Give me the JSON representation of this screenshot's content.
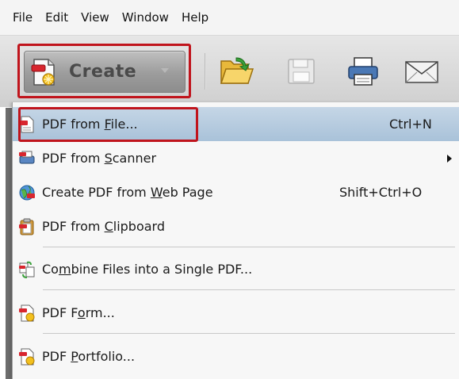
{
  "menubar": {
    "items": [
      "File",
      "Edit",
      "View",
      "Window",
      "Help"
    ]
  },
  "toolbar": {
    "create_label": "Create",
    "icons": [
      "open-folder-icon",
      "save-icon",
      "print-icon",
      "email-icon"
    ]
  },
  "create_menu": {
    "items": [
      {
        "pre": "PDF from ",
        "key": "F",
        "post": "ile...",
        "shortcut": "Ctrl+N",
        "icon": "pdf-from-file-icon",
        "highlighted": true
      },
      {
        "pre": "PDF from ",
        "key": "S",
        "post": "canner",
        "shortcut": "",
        "icon": "scanner-icon",
        "submenu": true
      },
      {
        "pre": "Create PDF from ",
        "key": "W",
        "post": "eb Page",
        "shortcut": "Shift+Ctrl+O",
        "icon": "web-page-icon"
      },
      {
        "pre": "PDF from ",
        "key": "C",
        "post": "lipboard",
        "shortcut": "",
        "icon": "clipboard-icon"
      },
      {
        "pre": "Co",
        "key": "m",
        "post": "bine Files into a Single PDF...",
        "shortcut": "",
        "icon": "combine-files-icon"
      },
      {
        "pre": "PDF F",
        "key": "o",
        "post": "rm...",
        "shortcut": "",
        "icon": "pdf-form-icon"
      },
      {
        "pre": "PDF ",
        "key": "P",
        "post": "ortfolio...",
        "shortcut": "",
        "icon": "pdf-portfolio-icon"
      }
    ]
  },
  "colors": {
    "highlight_frame": "#c0141c",
    "menu_highlight": "#b4cadf"
  }
}
